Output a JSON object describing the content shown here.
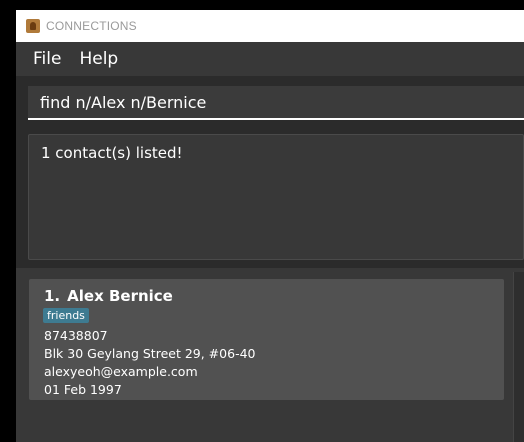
{
  "window": {
    "title": "CONNECTIONS"
  },
  "menu": {
    "file": "File",
    "help": "Help"
  },
  "command": {
    "value": "find n/Alex n/Bernice"
  },
  "result": {
    "message": "1 contact(s) listed!"
  },
  "contacts": [
    {
      "index": "1.",
      "name": "Alex Bernice",
      "tags": [
        "friends"
      ],
      "phone": "87438807",
      "address": "Blk 30 Geylang Street 29, #06-40",
      "email": "alexyeoh@example.com",
      "birthday": "01 Feb 1997"
    }
  ],
  "colors": {
    "background": "#383838",
    "panel": "#2b2b2b",
    "card": "#515151",
    "tag": "#3e7b91"
  }
}
